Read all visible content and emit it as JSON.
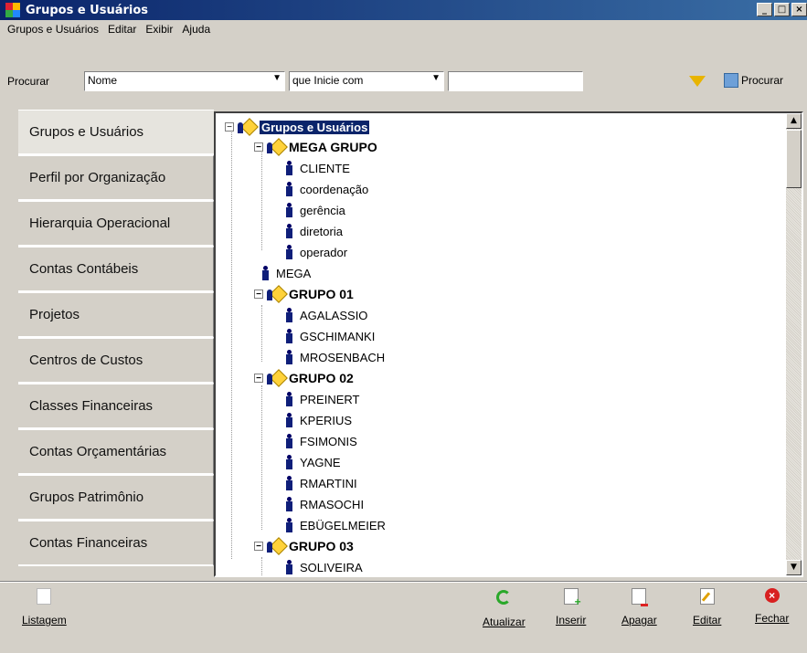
{
  "window": {
    "title": "Grupos e Usuários"
  },
  "menu": [
    "Grupos e Usuários",
    "Editar",
    "Exibir",
    "Ajuda"
  ],
  "search": {
    "label": "Procurar",
    "field_value": "Nome",
    "condition_value": "que Inicie com",
    "text_value": "",
    "button_label": "Procurar"
  },
  "sidebar": {
    "tabs": [
      "Grupos e Usuários",
      "Perfil por Organização",
      "Hierarquia Operacional",
      "Contas Contábeis",
      "Projetos",
      "Centros de Custos",
      "Classes Financeiras",
      "Contas Orçamentárias",
      "Grupos Patrimônio",
      "Contas Financeiras"
    ]
  },
  "tree": {
    "root": "Grupos e Usuários",
    "mega_grupo": "MEGA GRUPO",
    "mega_grupo_users": [
      "CLIENTE",
      "coordenação",
      "gerência",
      "diretoria",
      "operador"
    ],
    "mega_user": "MEGA",
    "grupo01": "GRUPO 01",
    "grupo01_users": [
      "AGALASSIO",
      "GSCHIMANKI",
      "MROSENBACH"
    ],
    "grupo02": "GRUPO 02",
    "grupo02_users": [
      "PREINERT",
      "KPERIUS",
      "FSIMONIS",
      "YAGNE",
      "RMARTINI",
      "RMASOCHI",
      "EBÜGELMEIER"
    ],
    "grupo03": "GRUPO 03",
    "grupo03_users": [
      "SOLIVEIRA"
    ]
  },
  "bottom": {
    "listagem": "Listagem",
    "atualizar": "Atualizar",
    "inserir": "Inserir",
    "apagar": "Apagar",
    "editar": "Editar",
    "fechar": "Fechar"
  }
}
